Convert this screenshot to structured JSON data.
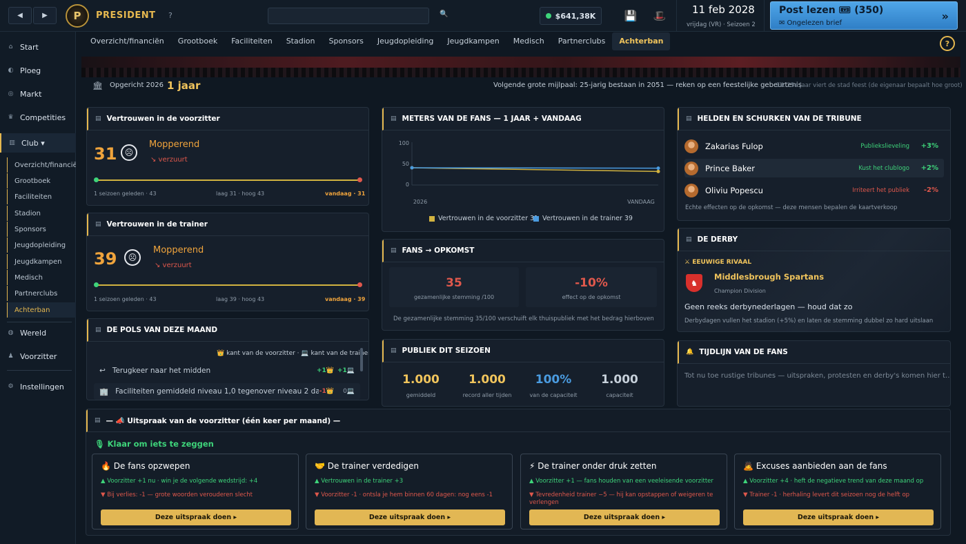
{
  "topbar": {
    "brand": "PRESIDENT",
    "help": "?",
    "money": "$641,38K",
    "date": "11 feb 2028",
    "date_sub": "vrijdag (VR) · Seizoen 2",
    "post_title": "Post lezen 🎟 (350)",
    "post_sub": "✉ Ongelezen brief",
    "post_arrow": "»"
  },
  "sidebar": {
    "items": [
      {
        "icon": "home-icon",
        "label": "Start"
      },
      {
        "icon": "team-icon",
        "label": "Ploeg"
      },
      {
        "icon": "market-icon",
        "label": "Markt"
      },
      {
        "icon": "trophy-icon",
        "label": "Competities"
      },
      {
        "icon": "club-icon",
        "label": "Club ▾"
      },
      {
        "icon": "globe-icon",
        "label": "Wereld"
      },
      {
        "icon": "president-icon",
        "label": "Voorzitter"
      },
      {
        "icon": "settings-icon",
        "label": "Instellingen"
      }
    ],
    "subitems": [
      "Overzicht/financiën",
      "Grootboek",
      "Faciliteiten",
      "Stadion",
      "Sponsors",
      "Jeugdopleiding",
      "Jeugdkampen",
      "Medisch",
      "Partnerclubs",
      "Achterban"
    ]
  },
  "tabs": [
    "Overzicht/financiën",
    "Grootboek",
    "Faciliteiten",
    "Stadion",
    "Sponsors",
    "Jeugdopleiding",
    "Jeugdkampen",
    "Medisch",
    "Partnerclubs",
    "Achterban"
  ],
  "founded": {
    "label": "Opgericht 2026",
    "value": "1 jaar",
    "milestone": "Volgende grote mijlpaal: 25-jarig bestaan in 2051 — reken op een feestelijke gebeurtenis",
    "note": "Elk 25e jaar viert de stad feest (de eigenaar bepaalt hoe groot)"
  },
  "trust_chair": {
    "title": "Vertrouwen in de voorzitter",
    "value": "31",
    "mood": "Mopperend",
    "trend": "↘ verzuurt",
    "left": "1 seizoen geleden · 43",
    "mid": "laag 31 · hoog 43",
    "right": "vandaag · 31",
    "start": 43,
    "end": 31
  },
  "trust_coach": {
    "title": "Vertrouwen in de trainer",
    "value": "39",
    "mood": "Mopperend",
    "trend": "↘ verzuurt",
    "left": "1 seizoen geleden · 43",
    "mid": "laag 39 · hoog 43",
    "right": "vandaag · 39",
    "start": 43,
    "end": 39
  },
  "pulse": {
    "title": "DE POLS VAN DEZE MAAND",
    "legend": "👑 kant van de voorzitter · 💻 kant van de trainer",
    "rows": [
      {
        "text": "Terugkeer naar het midden",
        "a": "+1👑",
        "b": "+1💻"
      },
      {
        "text": "Faciliteiten gemiddeld niveau 1,0 tegenover niveau 2 dat e…",
        "a": "-1👑",
        "b": "0💻"
      }
    ]
  },
  "meters": {
    "title": "METERS VAN DE FANS — 1 JAAR + VANDAAG"
  },
  "chart_data": {
    "type": "line",
    "x": [
      "2026",
      "VANDAAG"
    ],
    "ylim": [
      0,
      100
    ],
    "yticks": [
      "100",
      "50",
      "0"
    ],
    "series": [
      {
        "name": "Vertrouwen in de voorzitter 31",
        "values": [
          40,
          31
        ],
        "color": "#d2b340"
      },
      {
        "name": "Vertrouwen in de trainer 39",
        "values": [
          40,
          39
        ],
        "color": "#4a9be0"
      }
    ]
  },
  "fans_opkomst": {
    "title": "FANS → OPKOMST",
    "mood_val": "35",
    "mood_lbl": "gezamenlijke stemming /100",
    "effect_val": "-10%",
    "effect_lbl": "effect op de opkomst",
    "note": "De gezamenlijke stemming 35/100 verschuift elk thuispubliek met het bedrag hierboven"
  },
  "publiek": {
    "title": "PUBLIEK DIT SEIZOEN",
    "stats": [
      {
        "v": "1.000",
        "l": "gemiddeld",
        "c": "#f0c45c"
      },
      {
        "v": "1.000",
        "l": "record aller tijden",
        "c": "#f0c45c"
      },
      {
        "v": "100%",
        "l": "van de capaciteit",
        "c": "#4a9be0"
      },
      {
        "v": "1.000",
        "l": "capaciteit",
        "c": "#c6d0da"
      }
    ]
  },
  "heroes": {
    "title": "HELDEN EN SCHURKEN VAN DE TRIBUNE",
    "rows": [
      {
        "name": "Zakarias Fulop",
        "tag": "Publiekslieveling",
        "delta": "+3%",
        "color": "#3ed47a"
      },
      {
        "name": "Prince Baker",
        "tag": "Kust het clublogo",
        "delta": "+2%",
        "color": "#3ed47a"
      },
      {
        "name": "Oliviu Popescu",
        "tag": "Irriteert het publiek",
        "delta": "-2%",
        "color": "#e0584c"
      }
    ],
    "note": "Echte effecten op de opkomst — deze mensen bepalen de kaartverkoop"
  },
  "derby": {
    "title": "DE DERBY",
    "rival_lbl": "⚔ EEUWIGE RIVAAL",
    "team": "Middlesbrough Spartans",
    "division": "Champion Division",
    "status": "Geen reeks derbynederlagen — houd dat zo",
    "note": "Derbydagen vullen het stadion (+5%) en laten de stemming dubbel zo hard uitslaan"
  },
  "timeline": {
    "title": "TIJDLIJN VAN DE FANS",
    "text": "Tot nu toe rustige tribunes — uitspraken, protesten en derby's komen hier t…"
  },
  "speech": {
    "title": "— 📣 Uitspraak van de voorzitter (één keer per maand) —",
    "ready": "🎙 Klaar om iets te zeggen",
    "options": [
      {
        "title": "🔥 De fans opzwepen",
        "up": "▲ Voorzitter +1 nu · win je de volgende wedstrijd: +4",
        "down": "▼ Bij verlies: -1 — grote woorden verouderen slecht",
        "btn": "Deze uitspraak doen ▸"
      },
      {
        "title": "🤝 De trainer verdedigen",
        "up": "▲ Vertrouwen in de trainer +3",
        "down": "▼ Voorzitter -1 · ontsla je hem binnen 60 dagen: nog eens -1",
        "btn": "Deze uitspraak doen ▸"
      },
      {
        "title": "⚡ De trainer onder druk zetten",
        "up": "▲ Voorzitter +1 — fans houden van een veeleisende voorzitter",
        "down": "▼ Tevredenheid trainer −5 — hij kan opstappen of weigeren te verlengen",
        "btn": "Deze uitspraak doen ▸"
      },
      {
        "title": "🙇 Excuses aanbieden aan de fans",
        "up": "▲ Voorzitter +4 · heft de negatieve trend van deze maand op",
        "down": "▼ Trainer -1 · herhaling levert dit seizoen nog de helft op",
        "btn": "Deze uitspraak doen ▸"
      }
    ]
  }
}
